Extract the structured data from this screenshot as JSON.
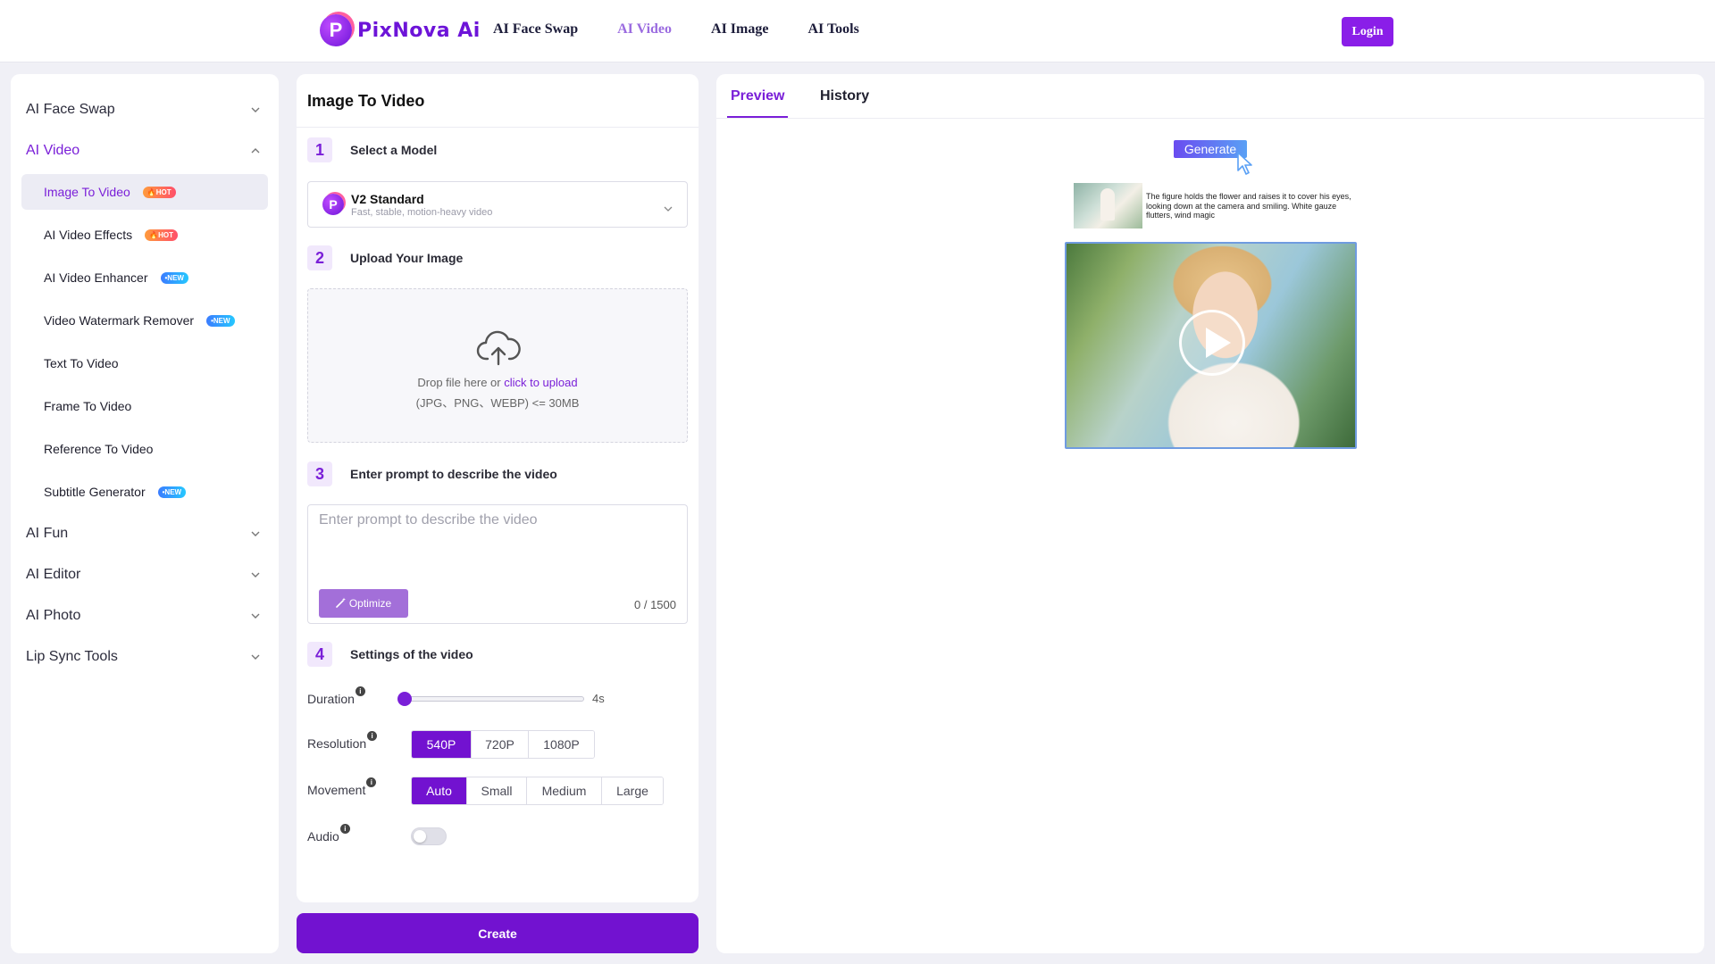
{
  "header": {
    "logo_text": "PixNova Ai",
    "logo_letter": "P",
    "nav": [
      "AI Face Swap",
      "AI Video",
      "AI Image",
      "AI Tools"
    ],
    "active_nav": "AI Video",
    "login_label": "Login"
  },
  "sidebar": {
    "categories": [
      {
        "label": "AI Face Swap",
        "expanded": false
      },
      {
        "label": "AI Video",
        "expanded": true
      },
      {
        "label": "AI Fun",
        "expanded": false
      },
      {
        "label": "AI Editor",
        "expanded": false
      },
      {
        "label": "AI Photo",
        "expanded": false
      },
      {
        "label": "Lip Sync Tools",
        "expanded": false
      }
    ],
    "video_items": [
      {
        "label": "Image To Video",
        "badge": "HOT",
        "active": true
      },
      {
        "label": "AI Video Effects",
        "badge": "HOT"
      },
      {
        "label": "AI Video Enhancer",
        "badge": "NEW"
      },
      {
        "label": "Video Watermark Remover",
        "badge": "NEW"
      },
      {
        "label": "Text To Video",
        "badge": ""
      },
      {
        "label": "Frame To Video",
        "badge": ""
      },
      {
        "label": "Reference To Video",
        "badge": ""
      },
      {
        "label": "Subtitle Generator",
        "badge": "NEW"
      }
    ]
  },
  "form": {
    "title": "Image To Video",
    "steps": [
      {
        "num": "1",
        "label": "Select a Model"
      },
      {
        "num": "2",
        "label": "Upload Your Image"
      },
      {
        "num": "3",
        "label": "Enter prompt to describe the video"
      },
      {
        "num": "4",
        "label": "Settings of the video"
      }
    ],
    "model": {
      "name": "V2 Standard",
      "description": "Fast, stable, motion-heavy video"
    },
    "upload": {
      "text_prefix": "Drop file here or ",
      "link_text": "click to upload",
      "formats": "(JPG、PNG、WEBP) <= 30MB"
    },
    "prompt": {
      "placeholder": "Enter prompt to describe the video",
      "value": "",
      "optimize_label": "Optimize",
      "char_count": "0 / 1500"
    },
    "settings": {
      "duration_label": "Duration",
      "duration_value": "4s",
      "duration_fraction": 0.0,
      "resolution_label": "Resolution",
      "resolution_options": [
        "540P",
        "720P",
        "1080P"
      ],
      "resolution_selected": "540P",
      "movement_label": "Movement",
      "movement_options": [
        "Auto",
        "Small",
        "Medium",
        "Large"
      ],
      "movement_selected": "Auto",
      "audio_label": "Audio",
      "audio_on": false,
      "info_glyph": "i"
    },
    "create_label": "Create"
  },
  "preview": {
    "tabs": [
      "Preview",
      "History"
    ],
    "active_tab": "Preview",
    "demo": {
      "generate_label": "Generate",
      "caption": "The figure holds the flower and raises it to cover his eyes, looking down at the camera and smiling. White gauze flutters, wind magic"
    }
  },
  "colors": {
    "accent": "#7212d0",
    "accent_light": "#a36fd9",
    "nav_active": "#9b6ce0",
    "badge_hot": "#ff6a4f",
    "badge_new": "#3b7cff"
  }
}
